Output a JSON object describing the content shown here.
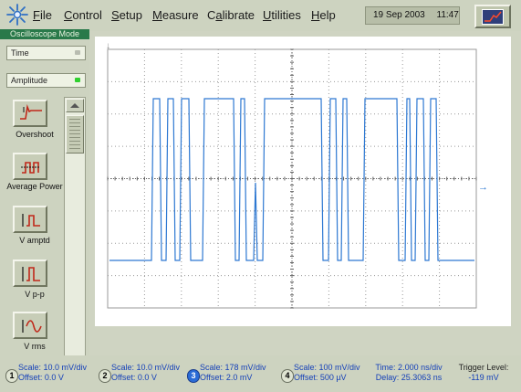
{
  "menu": {
    "items": [
      {
        "label": "File",
        "key": "F"
      },
      {
        "label": "Control",
        "key": "C"
      },
      {
        "label": "Setup",
        "key": "S"
      },
      {
        "label": "Measure",
        "key": "M"
      },
      {
        "label": "Calibrate",
        "key": "a"
      },
      {
        "label": "Utilities",
        "key": "U"
      },
      {
        "label": "Help",
        "key": "H"
      }
    ],
    "date": "19 Sep 2003",
    "time": "11:47",
    "app_icon": "starburst-icon",
    "mode_icon": "scope-waveform-icon"
  },
  "sidebar": {
    "mode_label": "Oscilloscope Mode",
    "time_field": "Time",
    "amplitude_field": "Amplitude",
    "time_led_color": "#b8bcb0",
    "amplitude_led_color": "#2fd02f",
    "measurements": [
      {
        "label": "Overshoot",
        "icon": "overshoot-icon"
      },
      {
        "label": "Average Power",
        "icon": "average-power-icon"
      },
      {
        "label": "V amptd",
        "icon": "v-amptd-icon"
      },
      {
        "label": "V p-p",
        "icon": "v-pp-icon"
      },
      {
        "label": "V rms",
        "icon": "v-rms-icon"
      }
    ]
  },
  "display": {
    "trace_color": "#2d78d2",
    "grid_color": "#8a8a8a",
    "trigger_marker": "↓",
    "level_marker": "→"
  },
  "channels": [
    {
      "number": "1",
      "scale": "Scale: 10.0 mV/div",
      "offset": "Offset: 0.0 V",
      "active": false
    },
    {
      "number": "2",
      "scale": "Scale: 10.0 mV/div",
      "offset": "Offset: 0.0 V",
      "active": false
    },
    {
      "number": "3",
      "scale": "Scale: 178 mV/div",
      "offset": "Offset: 2.0 mV",
      "active": true
    },
    {
      "number": "4",
      "scale": "Scale: 100 mV/div",
      "offset": "Offset: 500 µV",
      "active": false
    }
  ],
  "timebase": {
    "time": "Time: 2.000 ns/div",
    "delay": "Delay: 25.3063 ns"
  },
  "trigger": {
    "label": "Trigger Level:",
    "value": "-119 mV"
  }
}
